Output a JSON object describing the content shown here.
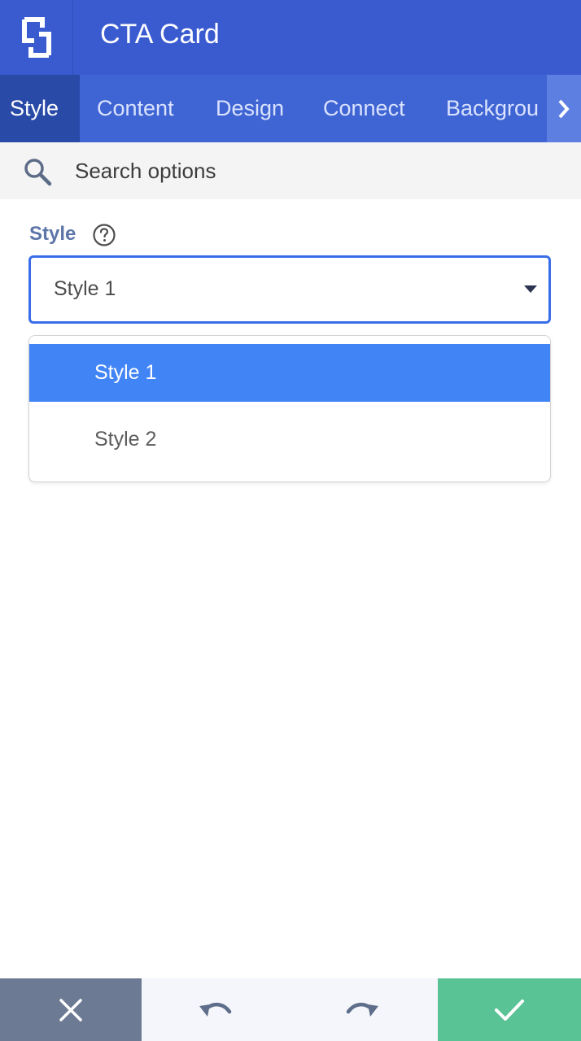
{
  "header": {
    "title": "CTA Card",
    "logo_icon": "divi-logo-icon",
    "bg_color": "#3a5bd0"
  },
  "tabs": [
    {
      "label": "Style",
      "active": true
    },
    {
      "label": "Content",
      "active": false
    },
    {
      "label": "Design",
      "active": false
    },
    {
      "label": "Connect",
      "active": false
    },
    {
      "label": "Backgrou",
      "active": false
    }
  ],
  "tabs_next_icon": "chevron-right-icon",
  "search": {
    "placeholder": "Search options",
    "icon": "search-icon"
  },
  "style_field": {
    "label": "Style",
    "help_icon": "question-circle-icon",
    "value": "Style 1",
    "options": [
      {
        "label": "Style 1",
        "selected": true
      },
      {
        "label": "Style 2",
        "selected": false
      }
    ],
    "accent_color": "#4184f6"
  },
  "footer": {
    "cancel_icon": "close-icon",
    "undo_icon": "undo-icon",
    "redo_icon": "redo-icon",
    "save_icon": "check-icon",
    "cancel_color": "#6c7a93",
    "save_color": "#5ac396"
  }
}
